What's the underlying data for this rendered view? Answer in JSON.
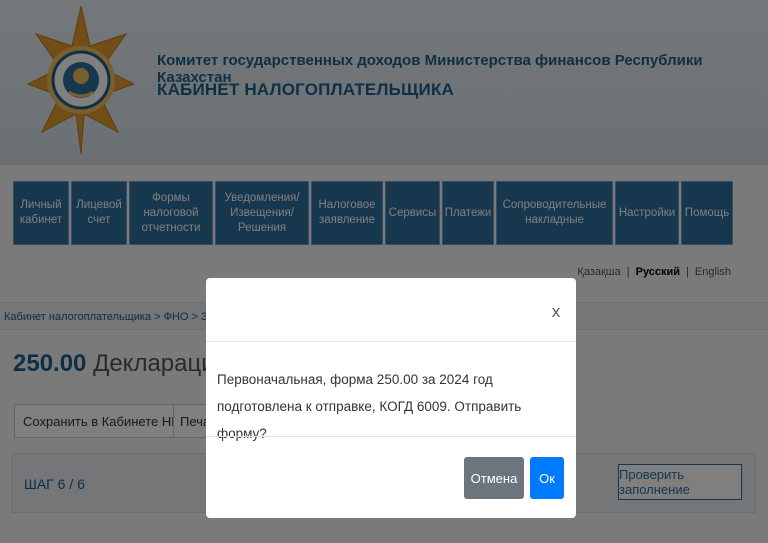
{
  "header": {
    "title": "Комитет государственных доходов Министерства финансов Республики Казахстан",
    "subtitle": "КАБИНЕТ НАЛОГОПЛАТЕЛЬЩИКА"
  },
  "nav": {
    "items": [
      {
        "label": "Личный кабинет"
      },
      {
        "label": "Лицевой счет"
      },
      {
        "label": "Формы налоговой отчетности"
      },
      {
        "label": "Уведомления/ Извещения/ Решения"
      },
      {
        "label": "Налоговое заявление"
      },
      {
        "label": "Сервисы"
      },
      {
        "label": "Платежи"
      },
      {
        "label": "Сопроводительные накладные"
      },
      {
        "label": "Настройки"
      },
      {
        "label": "Помощь"
      }
    ]
  },
  "languages": {
    "kazakh": "Қазақша",
    "russian": "Русский",
    "english": "English",
    "separator": "|"
  },
  "breadcrumb": {
    "text": "Кабинет налогоплательщика > ФНО > Заполнение"
  },
  "form": {
    "code": "250.00",
    "title": "Декларация об а"
  },
  "toolbar": {
    "save_label": "Сохранить в Кабинете НП",
    "caret": "▼",
    "print_label": "Печат"
  },
  "step": {
    "label": "ШАГ 6 / 6",
    "check_label": "Проверить заполнение"
  },
  "modal": {
    "close": "x",
    "message": "Первоначальная, форма 250.00 за 2024 год подготовлена к отправке, КОГД 6009. Отправить форму?",
    "cancel_label": "Отмена",
    "ok_label": "Ок"
  },
  "colors": {
    "brand_blue": "#2d6e9c",
    "ok_button": "#007bff",
    "cancel_button": "#6c757d"
  }
}
